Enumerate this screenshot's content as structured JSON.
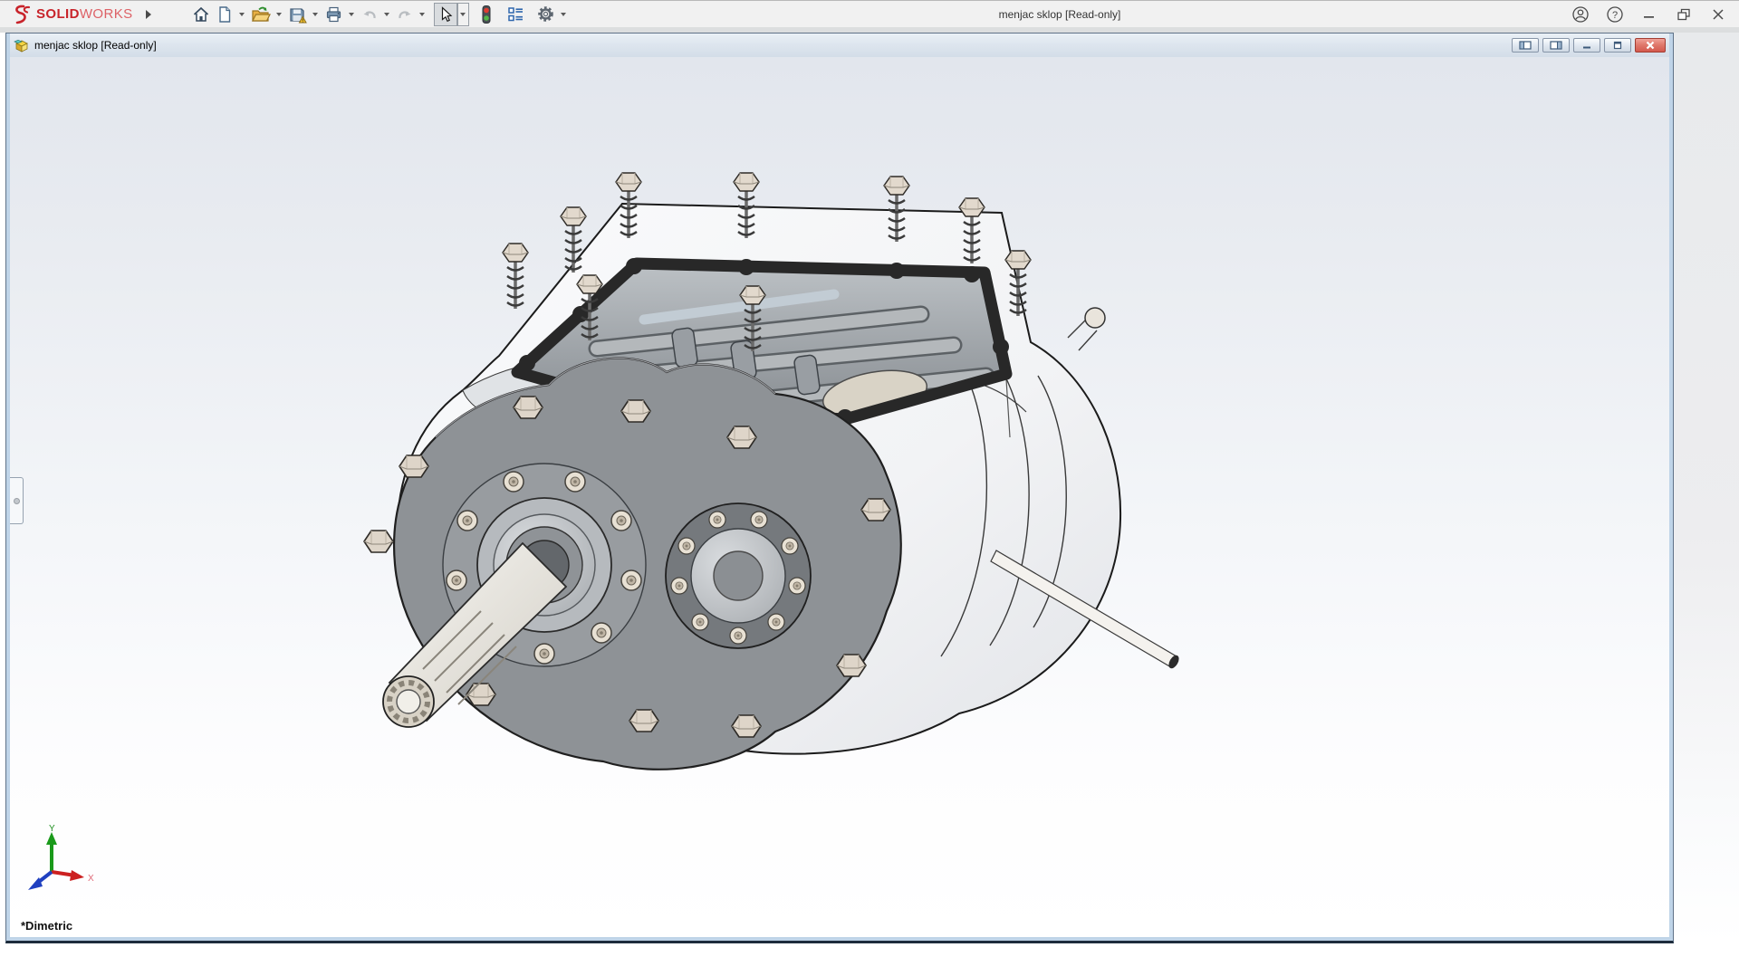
{
  "window": {
    "title": "menjac sklop [Read-only]",
    "brand": {
      "name_bold": "SOLID",
      "name_light": "WORKS"
    },
    "controls": [
      {
        "name": "account"
      },
      {
        "name": "help",
        "glyph": "?"
      },
      {
        "name": "minimize"
      },
      {
        "name": "restore"
      },
      {
        "name": "close"
      }
    ]
  },
  "toolbar": {
    "buttons": [
      {
        "name": "home"
      },
      {
        "name": "new-document",
        "has_dropdown": true
      },
      {
        "name": "open",
        "has_dropdown": true
      },
      {
        "name": "save",
        "has_dropdown": true,
        "badge": "warning"
      },
      {
        "name": "print",
        "has_dropdown": true
      },
      {
        "name": "undo",
        "enabled": false,
        "has_dropdown": true
      },
      {
        "name": "redo",
        "enabled": false,
        "has_dropdown": true
      },
      {
        "name": "select",
        "active": true,
        "has_dropdown": true
      },
      {
        "name": "traffic-light"
      },
      {
        "name": "report-list"
      },
      {
        "name": "options-gear",
        "has_dropdown": true
      }
    ]
  },
  "document_window": {
    "title": "menjac sklop [Read-only]",
    "icon": "assembly-document",
    "controls": [
      {
        "name": "split-pane-left"
      },
      {
        "name": "split-pane-right"
      },
      {
        "name": "minimize"
      },
      {
        "name": "restore"
      },
      {
        "name": "close"
      }
    ]
  },
  "viewport": {
    "view_orientation": "*Dimetric",
    "triad": {
      "x_label": "X",
      "y_label": "Y"
    },
    "model_description": "gearbox assembly 3D model"
  },
  "colors": {
    "brand_red": "#c8242b",
    "close_button_red": "#d4594e",
    "viewport_top": "#e2e6ed",
    "viewport_bottom": "#ffffff",
    "plate_gray": "#8e9296",
    "bolt_beige": "#ded5c9",
    "triad_x": "#cc2020",
    "triad_y": "#1a9a1a",
    "triad_z": "#2040c0"
  }
}
